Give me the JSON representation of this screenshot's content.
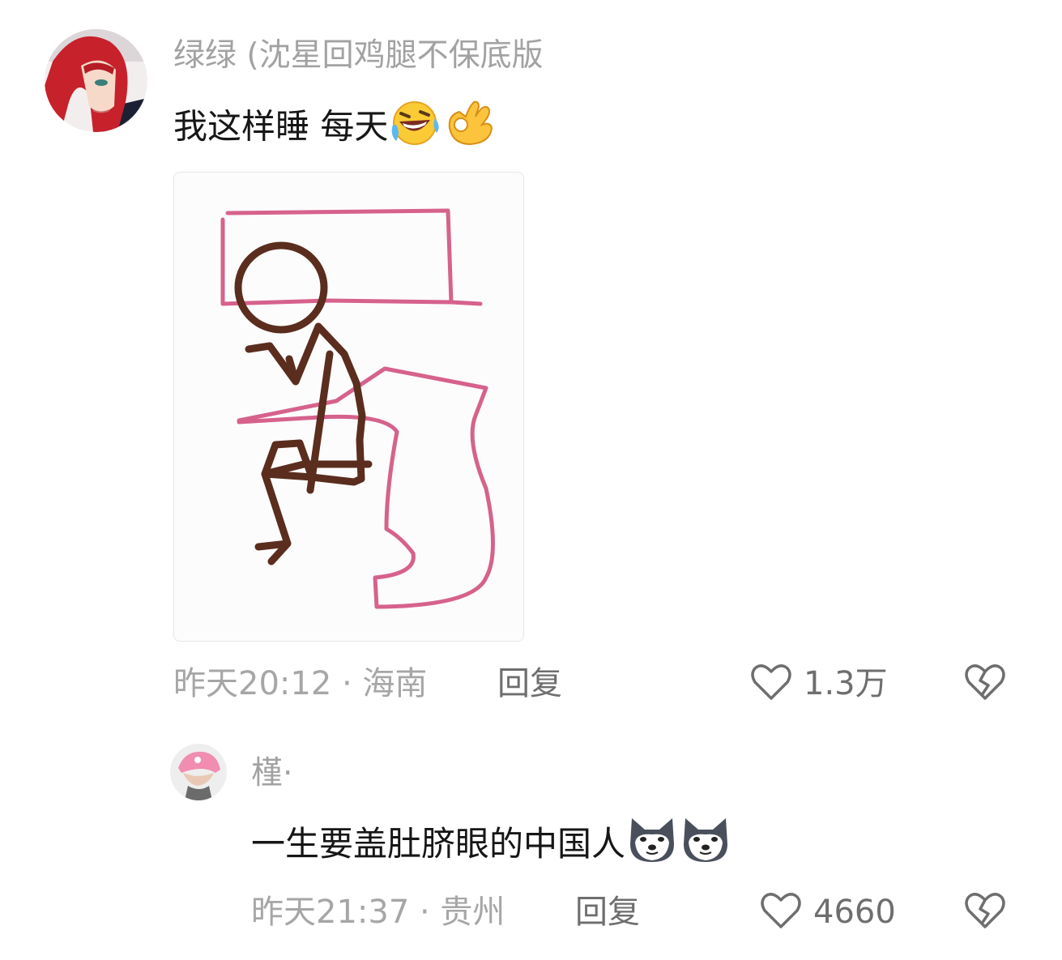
{
  "comments": [
    {
      "username": "绿绿 (沈星回鸡腿不保底版",
      "text": "我这样睡 每天",
      "emojis": [
        "rolling-laughing-emoji",
        "ok-hand-emoji"
      ],
      "timestamp": "昨天20:12 · 海南",
      "reply_label": "回复",
      "likes": "1.3万"
    },
    {
      "username": "槿·",
      "text": "一生要盖肚脐眼的中国人",
      "emojis": [
        "husky-dog-emoji",
        "husky-dog-emoji"
      ],
      "timestamp": "昨天21:37 · 贵州",
      "reply_label": "回复",
      "likes": "4660"
    }
  ],
  "icons": {
    "like": "heart-outline-icon",
    "dislike": "broken-heart-icon"
  },
  "colors": {
    "username": "#a2a2a2",
    "text": "#161616",
    "meta": "#a6a6a6",
    "action": "#6e6e6e",
    "drawing_bed": "#d2517f",
    "drawing_figure": "#5a2d1e"
  }
}
